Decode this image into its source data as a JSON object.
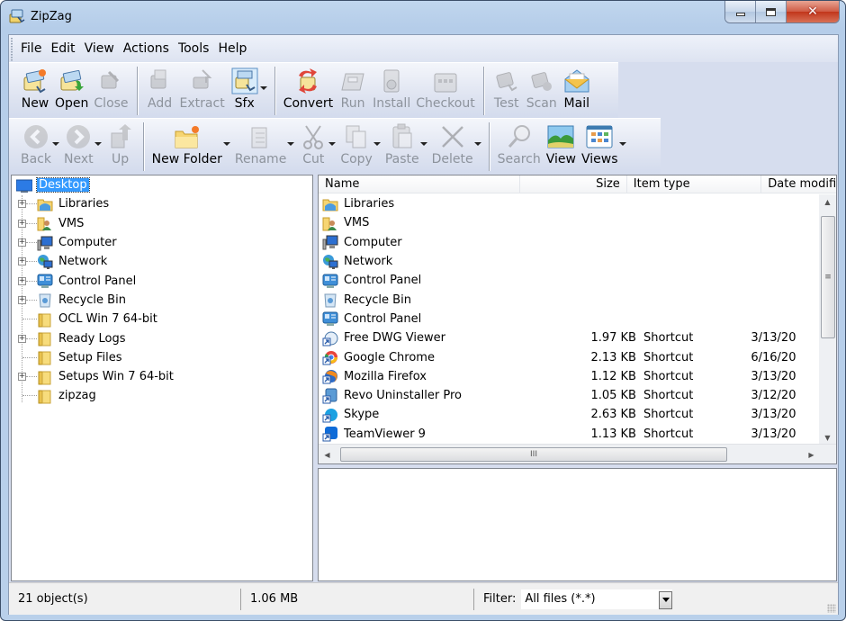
{
  "window": {
    "title": "ZipZag",
    "app_icon": "zipzag-app-icon",
    "caption_buttons": {
      "minimize": "minimize-icon",
      "maximize": "maximize-icon",
      "close": "close-icon"
    }
  },
  "menubar": {
    "items": [
      {
        "label": "File"
      },
      {
        "label": "Edit"
      },
      {
        "label": "View"
      },
      {
        "label": "Actions"
      },
      {
        "label": "Tools"
      },
      {
        "label": "Help"
      }
    ]
  },
  "toolbar_main": {
    "groups": [
      [
        {
          "label": "New",
          "icon": "new-archive-icon",
          "enabled": true
        },
        {
          "label": "Open",
          "icon": "open-archive-icon",
          "enabled": true
        },
        {
          "label": "Close",
          "icon": "close-archive-icon",
          "enabled": false
        }
      ],
      [
        {
          "label": "Add",
          "icon": "add-files-icon",
          "enabled": false
        },
        {
          "label": "Extract",
          "icon": "extract-icon",
          "enabled": false
        },
        {
          "label": "Sfx",
          "icon": "sfx-icon",
          "enabled": true,
          "dropdown": true
        }
      ],
      [
        {
          "label": "Convert",
          "icon": "convert-icon",
          "enabled": true
        },
        {
          "label": "Run",
          "icon": "run-icon",
          "enabled": false
        },
        {
          "label": "Install",
          "icon": "install-icon",
          "enabled": false
        },
        {
          "label": "Checkout",
          "icon": "checkout-icon",
          "enabled": false
        }
      ],
      [
        {
          "label": "Test",
          "icon": "test-icon",
          "enabled": false
        },
        {
          "label": "Scan",
          "icon": "scan-icon",
          "enabled": false
        },
        {
          "label": "Mail",
          "icon": "mail-icon",
          "enabled": true
        }
      ]
    ]
  },
  "toolbar_nav": {
    "groups": [
      [
        {
          "label": "Back",
          "icon": "back-arrow-icon",
          "enabled": false,
          "dropdown": true
        },
        {
          "label": "Next",
          "icon": "forward-arrow-icon",
          "enabled": false,
          "dropdown": true
        },
        {
          "label": "Up",
          "icon": "up-folder-icon",
          "enabled": false
        }
      ],
      [
        {
          "label": "New Folder",
          "icon": "new-folder-icon",
          "enabled": true,
          "dropdown": true
        },
        {
          "label": "Rename",
          "icon": "rename-icon",
          "enabled": false,
          "dropdown": true
        },
        {
          "label": "Cut",
          "icon": "scissors-icon",
          "enabled": false,
          "dropdown": true
        },
        {
          "label": "Copy",
          "icon": "copy-icon",
          "enabled": false,
          "dropdown": true
        },
        {
          "label": "Paste",
          "icon": "paste-icon",
          "enabled": false,
          "dropdown": true
        },
        {
          "label": "Delete",
          "icon": "delete-x-icon",
          "enabled": false,
          "dropdown": true
        }
      ],
      [
        {
          "label": "Search",
          "icon": "magnifier-icon",
          "enabled": false
        },
        {
          "label": "View",
          "icon": "picture-view-icon",
          "enabled": true
        },
        {
          "label": "Views",
          "icon": "views-grid-icon",
          "enabled": true,
          "dropdown": true
        }
      ]
    ]
  },
  "tree": {
    "root": {
      "label": "Desktop",
      "icon": "desktop-icon",
      "selected": true
    },
    "items": [
      {
        "label": "Libraries",
        "icon": "libraries-icon",
        "expandable": true
      },
      {
        "label": "VMS",
        "icon": "user-folder-icon",
        "expandable": true
      },
      {
        "label": "Computer",
        "icon": "computer-icon",
        "expandable": true
      },
      {
        "label": "Network",
        "icon": "network-icon",
        "expandable": true
      },
      {
        "label": "Control Panel",
        "icon": "control-panel-icon",
        "expandable": true
      },
      {
        "label": "Recycle Bin",
        "icon": "recycle-bin-icon",
        "expandable": true
      },
      {
        "label": "OCL Win 7 64-bit",
        "icon": "folder-icon",
        "expandable": false
      },
      {
        "label": "Ready Logs",
        "icon": "folder-icon",
        "expandable": true
      },
      {
        "label": "Setup Files",
        "icon": "folder-icon",
        "expandable": false
      },
      {
        "label": "Setups Win 7 64-bit",
        "icon": "folder-icon",
        "expandable": true
      },
      {
        "label": "zipzag",
        "icon": "folder-icon",
        "expandable": false
      }
    ]
  },
  "file_list": {
    "columns": {
      "name": "Name",
      "size": "Size",
      "type": "Item type",
      "date": "Date modifi"
    },
    "rows": [
      {
        "name": "Libraries",
        "icon": "libraries-icon",
        "size": "",
        "type": "",
        "date": ""
      },
      {
        "name": "VMS",
        "icon": "user-folder-icon",
        "size": "",
        "type": "",
        "date": ""
      },
      {
        "name": "Computer",
        "icon": "computer-icon",
        "size": "",
        "type": "",
        "date": ""
      },
      {
        "name": "Network",
        "icon": "network-icon",
        "size": "",
        "type": "",
        "date": ""
      },
      {
        "name": "Control Panel",
        "icon": "control-panel-icon",
        "size": "",
        "type": "",
        "date": ""
      },
      {
        "name": "Recycle Bin",
        "icon": "recycle-bin-icon",
        "size": "",
        "type": "",
        "date": ""
      },
      {
        "name": "Control Panel",
        "icon": "control-panel-icon",
        "size": "",
        "type": "",
        "date": ""
      },
      {
        "name": "Free DWG Viewer",
        "icon": "dwg-viewer-shortcut-icon",
        "size": "1.97 KB",
        "type": "Shortcut",
        "date": "3/13/20"
      },
      {
        "name": "Google Chrome",
        "icon": "chrome-shortcut-icon",
        "size": "2.13 KB",
        "type": "Shortcut",
        "date": "6/16/20"
      },
      {
        "name": "Mozilla Firefox",
        "icon": "firefox-shortcut-icon",
        "size": "1.12 KB",
        "type": "Shortcut",
        "date": "3/13/20"
      },
      {
        "name": "Revo Uninstaller Pro",
        "icon": "revo-shortcut-icon",
        "size": "1.05 KB",
        "type": "Shortcut",
        "date": "3/12/20"
      },
      {
        "name": "Skype",
        "icon": "skype-shortcut-icon",
        "size": "2.63 KB",
        "type": "Shortcut",
        "date": "3/13/20"
      },
      {
        "name": "TeamViewer 9",
        "icon": "teamviewer-shortcut-icon",
        "size": "1.13 KB",
        "type": "Shortcut",
        "date": "3/13/20"
      }
    ],
    "hscroll_grip": "III",
    "vscroll_grip": "≡"
  },
  "statusbar": {
    "object_count": "21 object(s)",
    "total_size": "1.06 MB",
    "filter_label": "Filter:",
    "filter_value": "All files (*.*)"
  },
  "colors": {
    "selection": "#3399ff",
    "frame": "#b9d0ea",
    "toolbar_bg": "#dfe4f1",
    "disabled_text": "#8d939c",
    "close_button": "#c1361b"
  }
}
